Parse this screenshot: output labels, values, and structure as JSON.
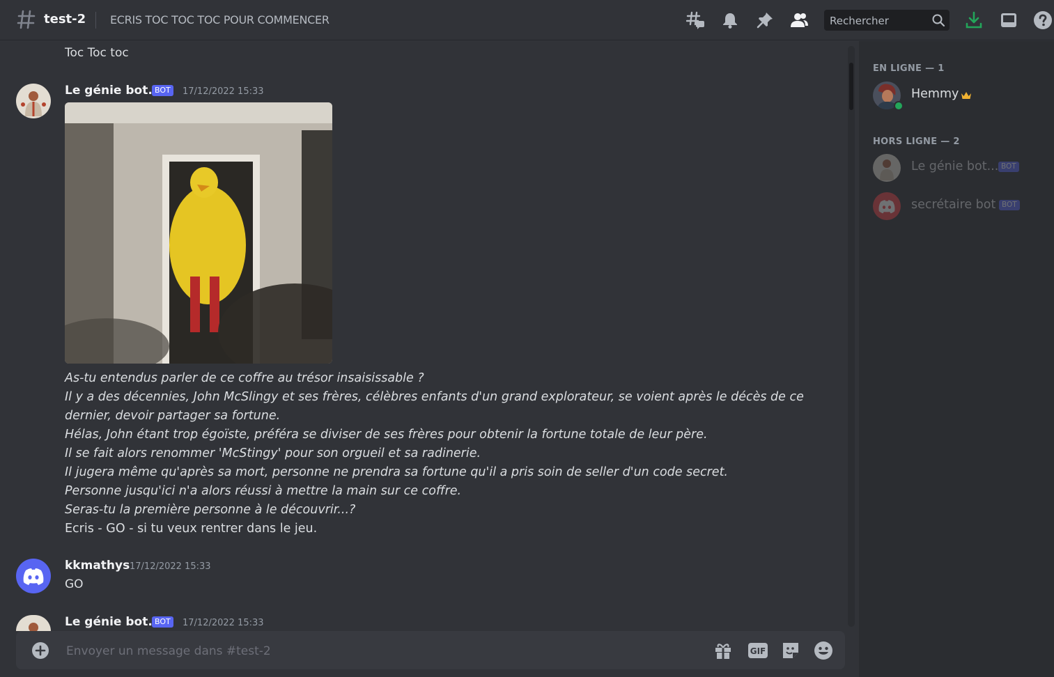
{
  "header": {
    "channel_name": "test-2",
    "topic": "ECRIS TOC TOC TOC POUR COMMENCER",
    "search_placeholder": "Rechercher"
  },
  "messages": {
    "first_line": "Toc Toc toc",
    "msg1": {
      "author": "Le génie bot...",
      "badge": "BOT",
      "timestamp": "17/12/2022 15:33",
      "story_lines": [
        "As-tu entendus parler de ce coffre au trésor insaisissable ?",
        " Il y a des décennies, John McSlingy et ses frères, célèbres enfants d'un grand explorateur, se voient après le décès de ce",
        "dernier, devoir partager sa fortune.",
        " Hélas, John étant trop égoïste, préféra se diviser de ses frères pour obtenir la fortune totale de leur père.",
        " Il se fait alors renommer 'McStingy' pour son orgueil et sa radinerie.",
        " Il jugera même qu'après sa mort, personne ne prendra sa fortune qu'il a  pris soin de seller d'un code secret.",
        " Personne jusqu'ici n'a alors réussi à mettre la main sur ce coffre.",
        " Seras-tu la première personne à le découvrir...?",
        " Ecris - GO - si tu veux rentrer dans le jeu."
      ]
    },
    "msg2": {
      "author": "kkmathys",
      "timestamp": "17/12/2022 15:33",
      "text": "GO"
    },
    "msg3": {
      "author": "Le génie bot...",
      "badge": "BOT",
      "timestamp": "17/12/2022 15:33"
    }
  },
  "composer": {
    "placeholder": "Envoyer un message dans #test-2",
    "gif_label": "GIF"
  },
  "members": {
    "online_header": "EN LIGNE — 1",
    "offline_header": "HORS LIGNE — 2",
    "online": [
      {
        "name": "Hemmy",
        "owner": true,
        "status": "online"
      }
    ],
    "offline": [
      {
        "name": "Le génie bot...",
        "badge": "BOT"
      },
      {
        "name": "secrétaire bot",
        "badge": "BOT"
      }
    ]
  },
  "colors": {
    "background": "#313338",
    "sidebar": "#2b2d31",
    "blurple": "#5865f2",
    "download_green": "#23a55a",
    "crown": "#f0b232"
  }
}
